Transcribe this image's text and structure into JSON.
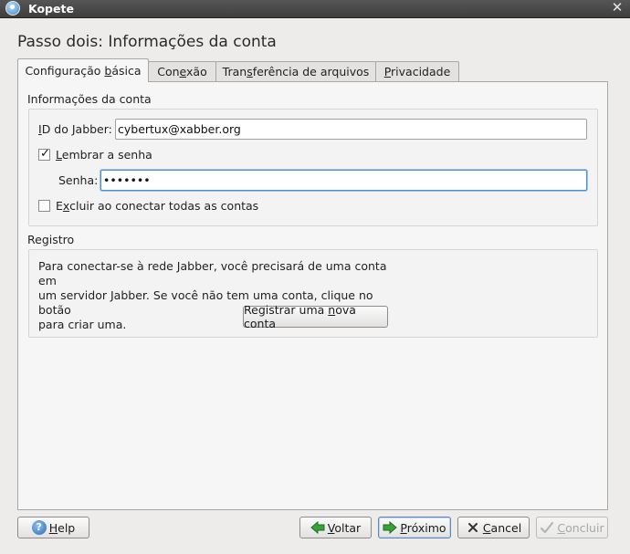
{
  "window": {
    "title": "Kopete"
  },
  "page": {
    "heading": "Passo dois: Informações da conta"
  },
  "tabs": [
    {
      "before": "Configuração ",
      "key": "b",
      "after": "ásica"
    },
    {
      "before": "Con",
      "key": "e",
      "after": "xão"
    },
    {
      "before": "Tran",
      "key": "s",
      "after": "ferência de arquivos"
    },
    {
      "before": "",
      "key": "P",
      "after": "rivacidade"
    }
  ],
  "account_info": {
    "group_title": "Informações da conta",
    "jabber_id_label": {
      "key": "I",
      "after": "D do Jabber:"
    },
    "jabber_id_value": "cybertux@xabber.org",
    "remember_password": {
      "key": "L",
      "after": "embrar a senha",
      "checked": true
    },
    "password_label": "Senha:",
    "password_value": "•••••••",
    "exclude_connect_all": {
      "before": "E",
      "key": "x",
      "after": "cluir ao conectar todas as contas",
      "checked": false
    }
  },
  "registration": {
    "group_title": "Registro",
    "line1": "Para conectar-se à rede Jabber, você precisará de uma conta em",
    "line2": "um servidor Jabber. Se você não tem uma conta, clique no botão",
    "line3": "para criar uma.",
    "register_button": {
      "before": "Registrar uma ",
      "key": "n",
      "after": "ova conta"
    }
  },
  "buttons": {
    "help": {
      "key": "H",
      "after": "elp"
    },
    "back": {
      "key": "V",
      "after": "oltar"
    },
    "next": {
      "key": "P",
      "after": "róximo"
    },
    "cancel": {
      "key": "C",
      "after": "ancel"
    },
    "finish": {
      "key": "C",
      "after": "oncluir"
    }
  },
  "colors": {
    "titlebar": "#4a4a4a",
    "window_bg": "#edeceb",
    "panel_bg": "#f6f6f6",
    "focus_border": "#4b8fd0",
    "arrow_green": "#3aa03a"
  },
  "icons": [
    "app-icon",
    "close-icon",
    "help-icon",
    "arrow-left-icon",
    "arrow-right-icon",
    "cancel-x-icon",
    "checkmark-icon"
  ]
}
